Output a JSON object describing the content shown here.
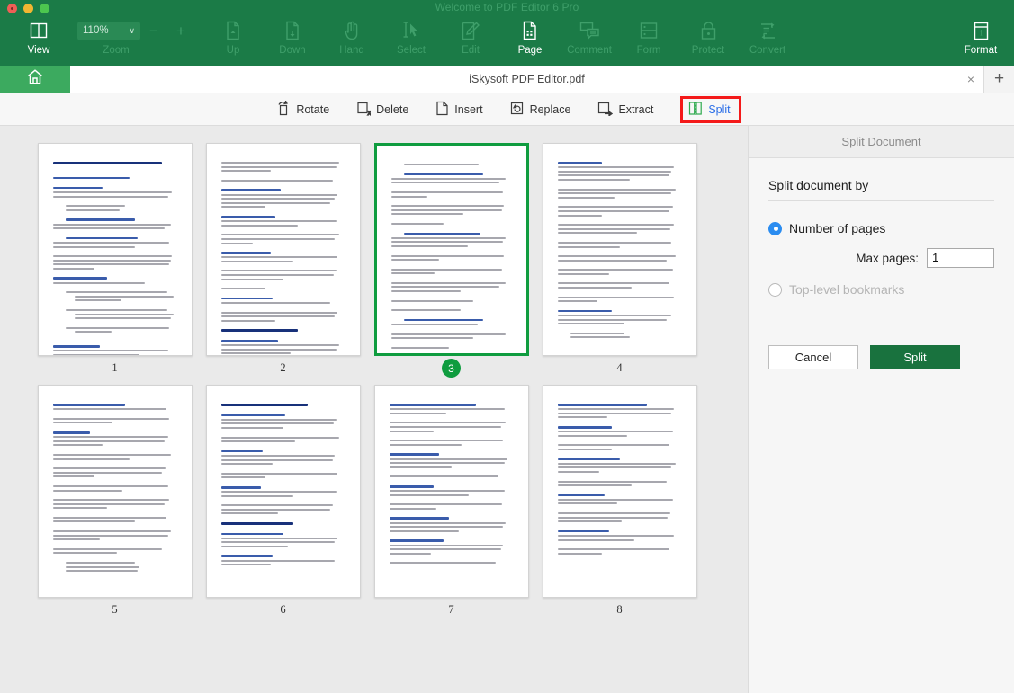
{
  "window": {
    "title": "Welcome to PDF Editor 6 Pro",
    "traffic": {
      "close": "close-button",
      "minimize": "minimize-button",
      "maximize": "maximize-button"
    }
  },
  "ribbon": {
    "view": {
      "label": "View",
      "icon": "columns-icon"
    },
    "zoom": {
      "label": "Zoom",
      "value": "110%",
      "caret": "∨",
      "minus": "−",
      "plus": "+"
    },
    "items": [
      {
        "label": "Up",
        "icon": "page-up-icon",
        "active": false
      },
      {
        "label": "Down",
        "icon": "page-down-icon",
        "active": false
      },
      {
        "label": "Hand",
        "icon": "hand-icon",
        "active": false
      },
      {
        "label": "Select",
        "icon": "cursor-select-icon",
        "active": false
      },
      {
        "label": "Edit",
        "icon": "pencil-edit-icon",
        "active": false
      },
      {
        "label": "Page",
        "icon": "page-grid-icon",
        "active": true
      },
      {
        "label": "Comment",
        "icon": "comment-bubble-icon",
        "active": false
      },
      {
        "label": "Form",
        "icon": "form-rows-icon",
        "active": false
      },
      {
        "label": "Protect",
        "icon": "lock-icon",
        "active": false
      },
      {
        "label": "Convert",
        "icon": "convert-arrows-icon",
        "active": false
      }
    ],
    "format": {
      "label": "Format",
      "icon": "info-box-icon",
      "active": true
    }
  },
  "tabbar": {
    "home_icon": "home-icon",
    "document_name": "iSkysoft PDF Editor.pdf",
    "close_glyph": "×",
    "add_glyph": "+"
  },
  "page_toolbar": {
    "tools": [
      {
        "label": "Rotate",
        "icon": "rotate-icon",
        "highlighted": false
      },
      {
        "label": "Delete",
        "icon": "delete-page-icon",
        "highlighted": false
      },
      {
        "label": "Insert",
        "icon": "insert-page-icon",
        "highlighted": false
      },
      {
        "label": "Replace",
        "icon": "replace-icon",
        "highlighted": false
      },
      {
        "label": "Extract",
        "icon": "extract-icon",
        "highlighted": false
      },
      {
        "label": "Split",
        "icon": "split-icon",
        "highlighted": true
      }
    ]
  },
  "thumbnails": {
    "selected_page": 3,
    "pages": [
      {
        "number": "1",
        "selected": false
      },
      {
        "number": "2",
        "selected": false
      },
      {
        "number": "3",
        "selected": true
      },
      {
        "number": "4",
        "selected": false
      },
      {
        "number": "5",
        "selected": false
      },
      {
        "number": "6",
        "selected": false
      },
      {
        "number": "7",
        "selected": false
      },
      {
        "number": "8",
        "selected": false
      }
    ]
  },
  "split_panel": {
    "title": "Split Document",
    "section_label": "Split document by",
    "option_pages": {
      "label": "Number of pages",
      "selected": true,
      "disabled": false
    },
    "max_pages": {
      "label": "Max pages:",
      "value": "1"
    },
    "option_bookmarks": {
      "label": "Top-level bookmarks",
      "selected": false,
      "disabled": true
    },
    "cancel_button": "Cancel",
    "split_button": "Split"
  },
  "colors": {
    "brand_green": "#1b7b47",
    "home_tab_green": "#3caa5f",
    "selection_green": "#0f9c3f",
    "primary_button_green": "#19723e",
    "highlight_red": "#f41a1a",
    "link_blue": "#2b6fe8",
    "radio_blue": "#2a8cf0",
    "canvas_gray": "#eaeaea",
    "panel_gray": "#f6f6f6"
  }
}
